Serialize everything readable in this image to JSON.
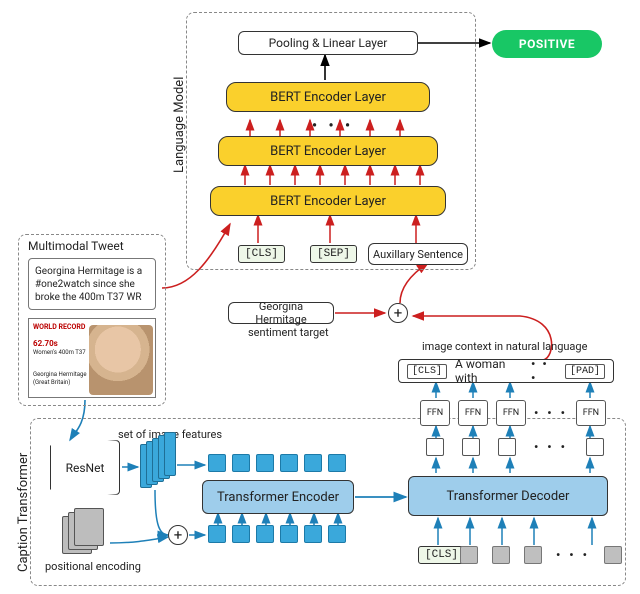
{
  "groups": {
    "lang_model": "Language Model",
    "multimodal": "Multimodal Tweet",
    "caption": "Caption Transformer"
  },
  "bert": {
    "layer1": "BERT Encoder Layer",
    "layer2": "BERT Encoder Layer",
    "layer3": "BERT Encoder Layer",
    "pool": "Pooling & Linear Layer",
    "cls": "[CLS]",
    "sep": "[SEP]",
    "aux": "Auxillary Sentence"
  },
  "output": {
    "positive": "POSITIVE"
  },
  "target": {
    "text": "Georgina Hermitage",
    "label": "sentiment target"
  },
  "context_label": "image context in natural language",
  "caption_seq": {
    "cls": "[CLS]",
    "text": "A woman with",
    "dots": "• • •",
    "pad": "[PAD]"
  },
  "ffn": {
    "label": "FFN",
    "dots": "• • •"
  },
  "encoder": {
    "label": "Transformer Encoder"
  },
  "decoder": {
    "label": "Transformer Decoder",
    "cls_in": "[CLS]",
    "dots": "• • •"
  },
  "resnet": {
    "label": "ResNet",
    "feat_label": "set of image features",
    "pos_enc": "positional encoding"
  },
  "tweet": {
    "text": "Georgina Hermitage is a #one2watch since she broke the 400m T37 WR",
    "img_banner": "WORLD RECORD",
    "img_time": "62.70s",
    "img_event": "Women's 400m T37",
    "img_name": "Georgina Hermitage",
    "img_country": "(Great Britain)"
  }
}
